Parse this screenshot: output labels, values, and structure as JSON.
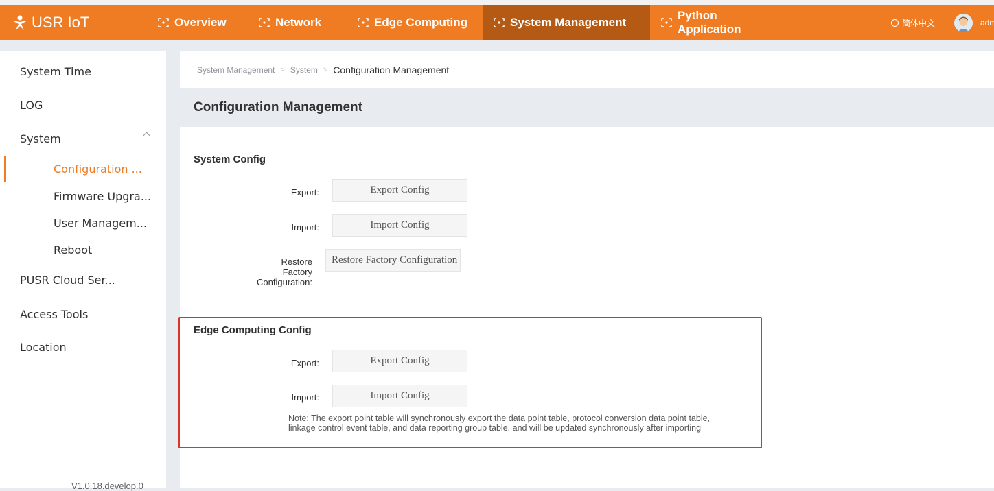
{
  "app": {
    "name": "USR IoT"
  },
  "nav": {
    "items": [
      {
        "label": "Overview"
      },
      {
        "label": "Network"
      },
      {
        "label": "Edge Computing"
      },
      {
        "label": "System Management"
      },
      {
        "label": "Python Application"
      }
    ],
    "language": "简体中文",
    "user": "adm"
  },
  "colors": {
    "brand": "#ef7b22",
    "nav_active": "#b55a14",
    "highlight_border": "#e0322b"
  },
  "sidebar": {
    "system_time": "System Time",
    "log": "LOG",
    "system": "System",
    "sub": [
      "Configuration ...",
      "Firmware Upgra...",
      "User Managem...",
      "Reboot"
    ],
    "pusr_cloud": "PUSR Cloud Ser...",
    "access_tools": "Access Tools",
    "location": "Location",
    "version": "V1.0.18.develop.0"
  },
  "breadcrumb": [
    "System Management",
    "System",
    "Configuration Management"
  ],
  "page_title": "Configuration Management",
  "system_config": {
    "title": "System Config",
    "export_label": "Export:",
    "export_button": "Export Config",
    "import_label": "Import:",
    "import_button": "Import Config",
    "restore_label_1": "Restore",
    "restore_label_2": "Factory",
    "restore_label_3": "Configuration:",
    "restore_button": "Restore Factory Configuration"
  },
  "edge_config": {
    "title": "Edge Computing Config",
    "export_label": "Export:",
    "export_button": "Export Config",
    "import_label": "Import:",
    "import_button": "Import Config",
    "note_line1": "Note: The export point table will synchronously export the data point table, protocol conversion data point table,",
    "note_line2": "linkage control event table, and data reporting group table, and will be updated synchronously after importing"
  }
}
